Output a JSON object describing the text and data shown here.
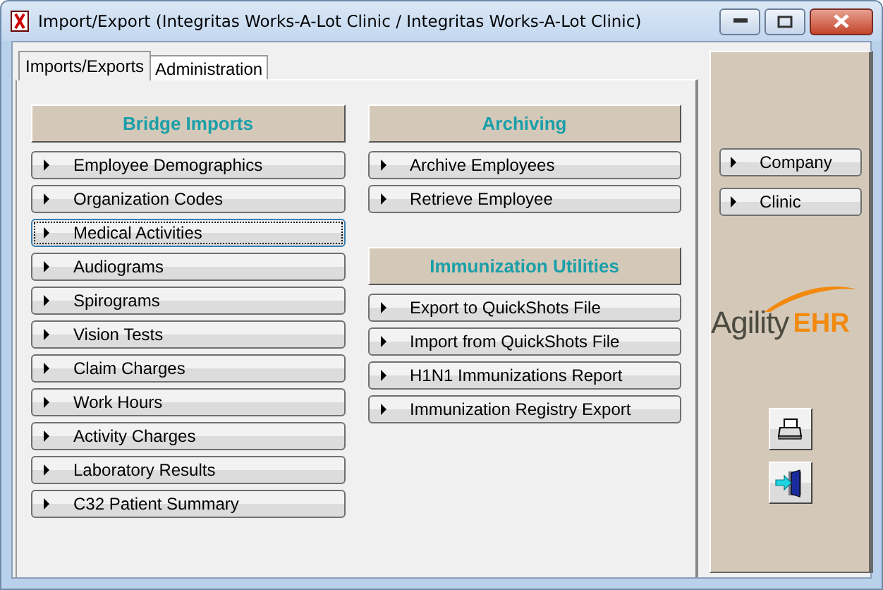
{
  "window": {
    "title": "Import/Export (Integritas Works-A-Lot Clinic / Integritas Works-A-Lot Clinic)"
  },
  "tabs": [
    {
      "label": "Imports/Exports",
      "selected": true
    },
    {
      "label": "Administration",
      "selected": false
    }
  ],
  "columns": [
    {
      "sections": [
        {
          "title": "Bridge Imports",
          "buttons": [
            {
              "label": "Employee Demographics",
              "focused": false
            },
            {
              "label": "Organization Codes",
              "focused": false
            },
            {
              "label": "Medical Activities",
              "focused": true
            },
            {
              "label": "Audiograms",
              "focused": false
            },
            {
              "label": "Spirograms",
              "focused": false
            },
            {
              "label": "Vision Tests",
              "focused": false
            },
            {
              "label": "Claim Charges",
              "focused": false
            },
            {
              "label": "Work Hours",
              "focused": false
            },
            {
              "label": "Activity Charges",
              "focused": false
            },
            {
              "label": "Laboratory Results",
              "focused": false
            },
            {
              "label": "C32 Patient Summary",
              "focused": false
            }
          ]
        }
      ]
    },
    {
      "sections": [
        {
          "title": "Archiving",
          "buttons": [
            {
              "label": "Archive Employees",
              "focused": false
            },
            {
              "label": "Retrieve Employee",
              "focused": false
            }
          ]
        },
        {
          "title": "Immunization Utilities",
          "buttons": [
            {
              "label": "Export to QuickShots File",
              "focused": false
            },
            {
              "label": "Import from QuickShots File",
              "focused": false
            },
            {
              "label": "H1N1 Immunizations Report",
              "focused": false
            },
            {
              "label": "Immunization Registry Export",
              "focused": false
            }
          ]
        }
      ]
    }
  ],
  "side_panel": {
    "buttons": [
      {
        "label": "Company"
      },
      {
        "label": "Clinic"
      }
    ],
    "logo": {
      "name": "Agility",
      "suffix": "EHR"
    }
  }
}
